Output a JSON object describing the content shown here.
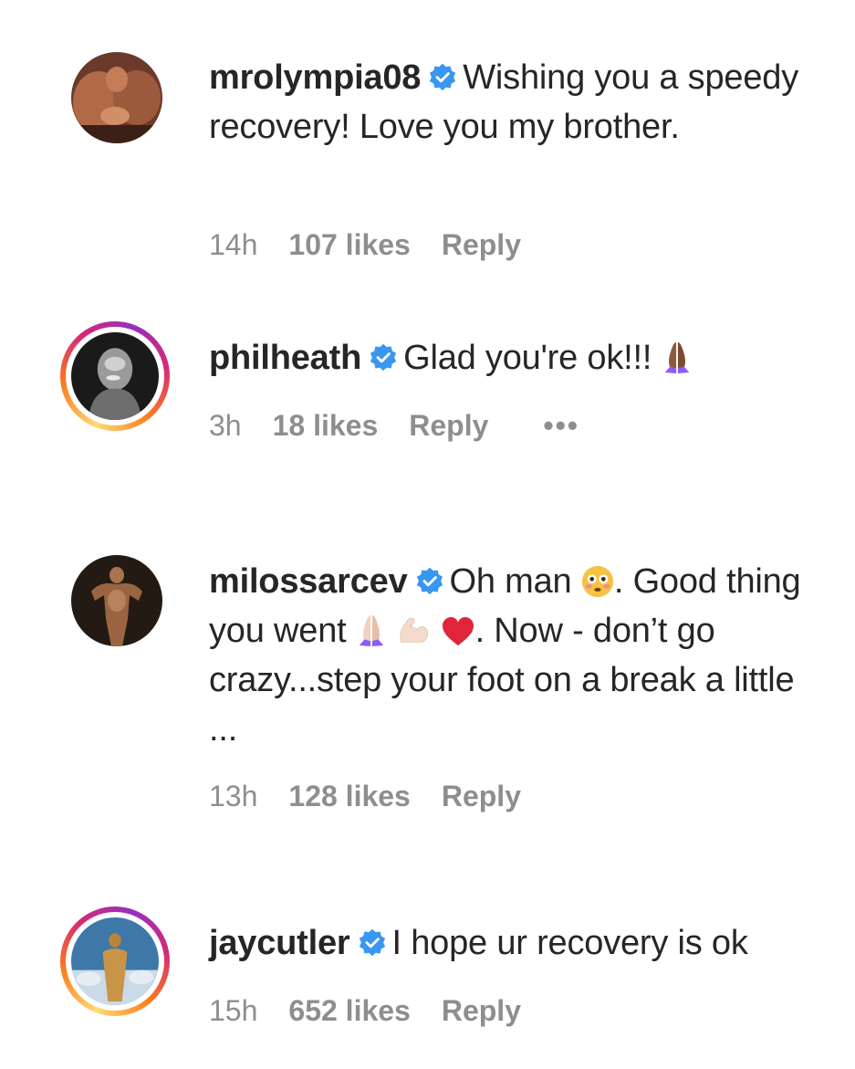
{
  "comments": [
    {
      "username": "mrolympia08",
      "text": "Wishing you a speedy recovery! Love you my brother.",
      "time": "14h",
      "likes": "107 likes",
      "reply": "Reply"
    },
    {
      "username": "philheath",
      "text": "Glad you're ok!!! ",
      "time": "3h",
      "likes": "18 likes",
      "reply": "Reply",
      "more": "•••"
    },
    {
      "username": "milossarcev",
      "text_1": "Oh man ",
      "text_2": ". Good thing you went ",
      "text_3": ". Now - don’t go crazy...step your foot on a break a little ...",
      "time": "13h",
      "likes": "128 likes",
      "reply": "Reply"
    },
    {
      "username": "jaycutler",
      "text": "I hope ur recovery is ok",
      "time": "15h",
      "likes": "652 likes",
      "reply": "Reply"
    }
  ],
  "icons": {
    "verified": "verified-badge-icon",
    "pray": "folded-hands-icon",
    "flushed": "flushed-face-icon",
    "muscle": "flexed-biceps-icon",
    "heart": "red-heart-icon"
  },
  "colors": {
    "verified_blue": "#3897f0",
    "meta_gray": "#8e8e8e",
    "text": "#262626"
  }
}
